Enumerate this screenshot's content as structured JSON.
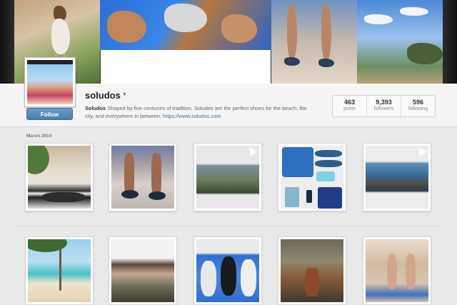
{
  "profile": {
    "username": "soludos",
    "bio_name": "Soludos",
    "bio_text": "Shaped by five centuries of tradition, Soludos are the perfect shoes for the beach, the city, and everywhere in between.",
    "bio_link": "https://www.soludos.com",
    "follow_label": "Follow"
  },
  "stats": [
    {
      "value": "463",
      "label": "posts"
    },
    {
      "value": "9,393",
      "label": "followers"
    },
    {
      "value": "596",
      "label": "following"
    }
  ],
  "feed": {
    "month_label": "March 2014"
  },
  "icons": {
    "caret": "caret-down-icon",
    "video": "video-play-icon"
  },
  "colors": {
    "follow_button": "#4d7ea9",
    "link": "#3f729b",
    "background": "#e9e9e9"
  }
}
